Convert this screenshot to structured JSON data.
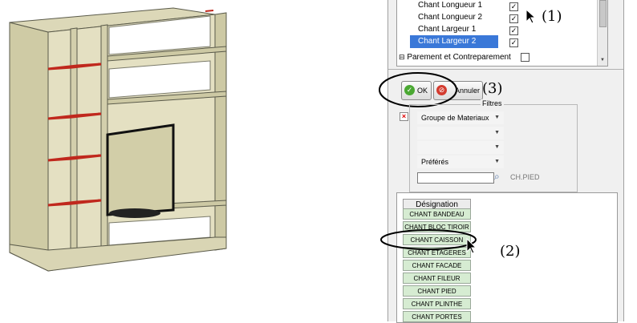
{
  "tree": {
    "items": [
      {
        "label": "Chant Longueur 1",
        "checked": true
      },
      {
        "label": "Chant Longueur 2",
        "checked": true
      },
      {
        "label": "Chant Largeur 1",
        "checked": true
      },
      {
        "label": "Chant Largeur 2",
        "checked": true,
        "selected": true
      }
    ],
    "parent": {
      "expander": "⊟",
      "label": "Parement et Contreparement",
      "checked": false
    }
  },
  "buttons": {
    "ok_label": "OK",
    "cancel_label": "Annuler"
  },
  "filters": {
    "title": "Filtres",
    "group": "Groupe de Materiaux",
    "combo2": "",
    "combo3": "",
    "preferes": "Préférés",
    "search_value": "",
    "search_result": "CH.PIED"
  },
  "grid": {
    "header": "Désignation",
    "rows": [
      "CHANT BANDEAU",
      "CHANT BLOC TIROIR",
      "CHANT CAISSON",
      "CHANT ETAGERES",
      "CHANT FACADE",
      "CHANT FILEUR",
      "CHANT PIED",
      "CHANT PLINTHE",
      "CHANT PORTES"
    ]
  },
  "annotations": {
    "a1": "(1)",
    "a2": "(2)",
    "a3": "(3)"
  },
  "icons": {
    "ok": "check-circle-icon",
    "cancel": "no-entry-icon",
    "remove": "red-x-icon",
    "search": "magnifier-icon",
    "cursor": "arrow-cursor-icon"
  },
  "colors": {
    "cabinet": "#d7d3b0",
    "edge_highlight": "#c0281d",
    "selection": "#3a78d8",
    "grid_cell": "#d6ecd2"
  }
}
